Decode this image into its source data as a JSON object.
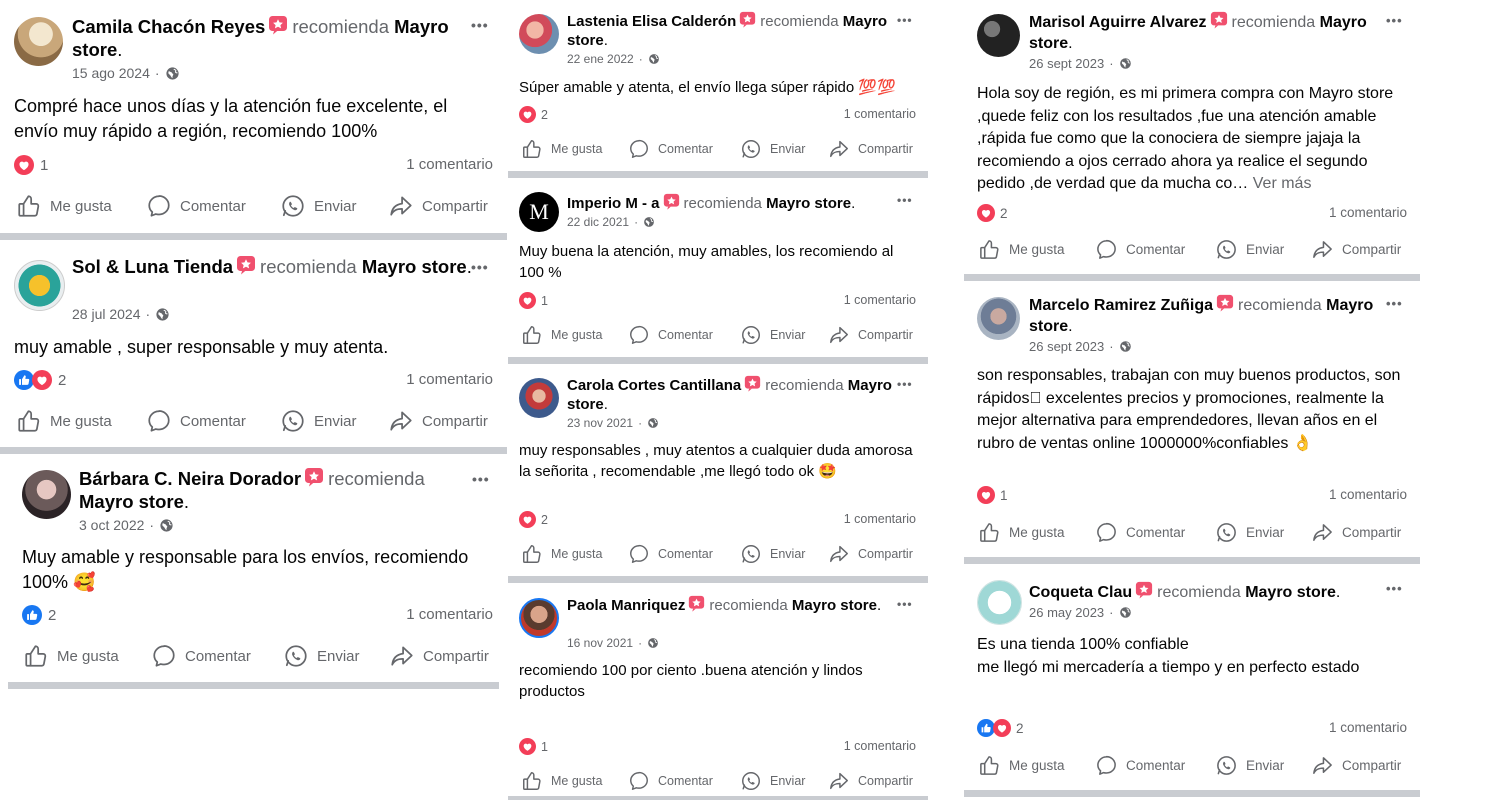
{
  "common": {
    "recommends": "recomienda",
    "page_name": "Mayro store",
    "page_dot": ".",
    "more_label": "•••",
    "meta_sep": "·",
    "comment_count": "1 comentario",
    "actions": {
      "like": "Me gusta",
      "comment": "Comentar",
      "send": "Enviar",
      "share": "Compartir"
    },
    "see_more": "Ver más"
  },
  "colors": {
    "like_blue": "#1877f2",
    "love_red": "#f33e58",
    "badge_pink": "#f0506e",
    "separator": "#c9ccd1",
    "secondary_text": "#65676b"
  },
  "posts": [
    {
      "author": "Camila Chacón Reyes",
      "date": "15 ago 2024",
      "text": "Compré hace unos días y la atención fue excelente, el envío muy rápido a región, recomiendo 100%",
      "reaction_count": "1",
      "reactions": [
        "love"
      ]
    },
    {
      "author": "Sol & Luna Tienda",
      "date": "28 jul 2024",
      "text": "muy amable , super responsable y muy atenta.",
      "reaction_count": "2",
      "reactions": [
        "like",
        "love"
      ]
    },
    {
      "author": "Bárbara C. Neira Dorador",
      "date": "3 oct 2022",
      "text": "Muy amable y responsable para los envíos, recomiendo 100% 🥰",
      "reaction_count": "2",
      "reactions": [
        "like"
      ]
    },
    {
      "author": "Lastenia Elisa Calderón",
      "date": "22 ene 2022",
      "text": "Súper amable y atenta, el envío llega súper rápido 💯💯",
      "reaction_count": "2",
      "reactions": [
        "love"
      ]
    },
    {
      "author": "Imperio M - a",
      "date": "22 dic 2021",
      "text": "Muy buena la atención, muy amables, los recomiendo al 100 %",
      "reaction_count": "1",
      "reactions": [
        "love"
      ]
    },
    {
      "author": "Carola Cortes Cantillana",
      "date": "23 nov 2021",
      "text": "muy responsables , muy atentos a cualquier duda amorosa la señorita , recomendable ,me llegó todo ok 🤩",
      "reaction_count": "2",
      "reactions": [
        "love"
      ]
    },
    {
      "author": "Paola Manriquez",
      "date": "16 nov 2021",
      "text": "recomiendo 100 por ciento .buena atención y lindos productos",
      "reaction_count": "1",
      "reactions": [
        "love"
      ]
    },
    {
      "author": "Marisol Aguirre Alvarez",
      "date": "26 sept 2023",
      "text": "Hola soy de región, es mi primera compra con Mayro store ,quede feliz con los resultados ,fue una atención amable ,rápida fue como que la conociera de siempre jajaja la recomiendo a ojos cerrado ahora ya realice el segundo pedido ,de verdad que da mucha co… ",
      "reaction_count": "2",
      "reactions": [
        "love"
      ]
    },
    {
      "author": "Marcelo Ramirez Zuñiga",
      "date": "26 sept 2023",
      "text": "son responsables, trabajan con muy buenos productos, son rápidos🏽 excelentes precios y promociones, realmente la mejor alternativa para emprendedores, llevan años en el rubro de ventas online 1000000%confiables 👌",
      "reaction_count": "1",
      "reactions": [
        "love"
      ]
    },
    {
      "author": "Coqueta Clau",
      "date": "26 may 2023",
      "text": "Es una tienda 100% confiable\nme llegó mi mercadería a tiempo y en perfecto estado",
      "reaction_count": "2",
      "reactions": [
        "like",
        "love"
      ]
    }
  ]
}
